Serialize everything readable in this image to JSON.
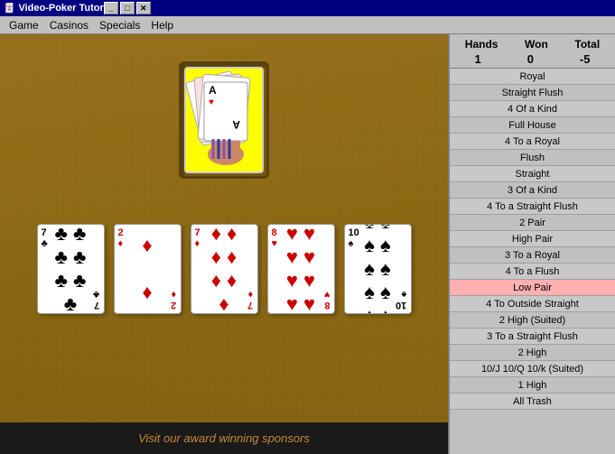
{
  "titleBar": {
    "icon": "🃏",
    "title": "Video-Poker Tutor",
    "btnMin": "_",
    "btnMax": "□",
    "btnClose": "✕"
  },
  "menu": {
    "items": [
      "Game",
      "Casinos",
      "Specials",
      "Help"
    ]
  },
  "stats": {
    "handsLabel": "Hands",
    "wonLabel": "Won",
    "totalLabel": "Total",
    "handsValue": "1",
    "wonValue": "0",
    "totalValue": "-5"
  },
  "handList": [
    {
      "label": "Royal",
      "highlighted": false
    },
    {
      "label": "Straight Flush",
      "highlighted": false
    },
    {
      "label": "4 Of a Kind",
      "highlighted": false
    },
    {
      "label": "Full House",
      "highlighted": false
    },
    {
      "label": "4 To a Royal",
      "highlighted": false
    },
    {
      "label": "Flush",
      "highlighted": false
    },
    {
      "label": "Straight",
      "highlighted": false
    },
    {
      "label": "3 Of a Kind",
      "highlighted": false
    },
    {
      "label": "4 To a Straight Flush",
      "highlighted": false
    },
    {
      "label": "2 Pair",
      "highlighted": false
    },
    {
      "label": "High Pair",
      "highlighted": false
    },
    {
      "label": "3 To a Royal",
      "highlighted": false
    },
    {
      "label": "4 To a Flush",
      "highlighted": false
    },
    {
      "label": "Low Pair",
      "highlighted": true
    },
    {
      "label": "4 To Outside  Straight",
      "highlighted": false
    },
    {
      "label": "2 High (Suited)",
      "highlighted": false
    },
    {
      "label": "3 To a Straight Flush",
      "highlighted": false
    },
    {
      "label": "2 High",
      "highlighted": false
    },
    {
      "label": "10/J 10/Q 10/k (Suited)",
      "highlighted": false
    },
    {
      "label": "1 High",
      "highlighted": false
    },
    {
      "label": "All Trash",
      "highlighted": false
    }
  ],
  "cards": [
    {
      "rank": "7",
      "suit": "♣",
      "suitSymbols": [
        "♣",
        "♣",
        "♣",
        "♣",
        "♣",
        "♣",
        "♣"
      ],
      "color": "black",
      "count": 7
    },
    {
      "rank": "2",
      "suit": "♦",
      "suitSymbols": [
        "♦",
        "♦"
      ],
      "color": "red",
      "count": 2
    },
    {
      "rank": "7",
      "suit": "♦",
      "suitSymbols": [
        "♦",
        "♦",
        "♦",
        "♦",
        "♦",
        "♦",
        "♦"
      ],
      "color": "red",
      "count": 7
    },
    {
      "rank": "8",
      "suit": "♥",
      "suitSymbols": [
        "♥",
        "♥",
        "♥",
        "♥",
        "♥",
        "♥",
        "♥",
        "♥"
      ],
      "color": "red",
      "count": 8
    },
    {
      "rank": "10",
      "suit": "♠",
      "suitSymbols": [
        "♠",
        "♠",
        "♠",
        "♠",
        "♠",
        "♠",
        "♠",
        "♠",
        "♠",
        "♠"
      ],
      "color": "black",
      "count": 10
    }
  ],
  "banner": {
    "text": "Visit our award winning sponsors"
  }
}
